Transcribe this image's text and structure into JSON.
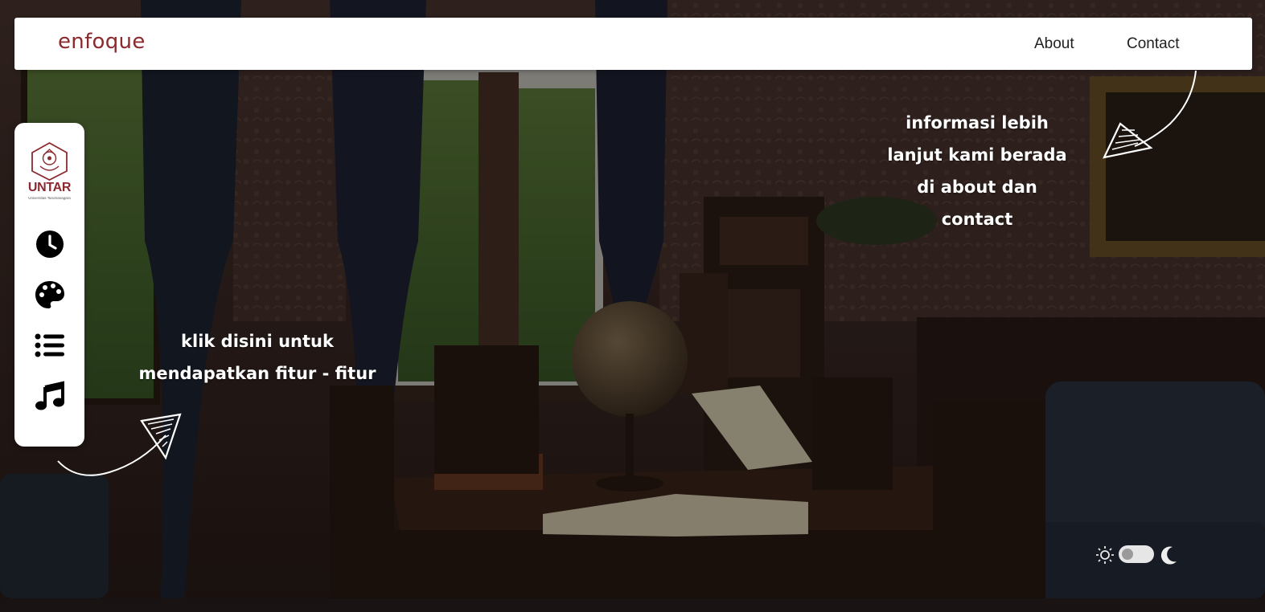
{
  "navbar": {
    "brand": "enfoque",
    "links": {
      "about": "About",
      "contact": "Contact"
    }
  },
  "sidebar": {
    "logo": {
      "text": "UNTAR",
      "subtext": "Universitas Tarumanagara"
    },
    "buttons": [
      {
        "icon": "clock-icon"
      },
      {
        "icon": "palette-icon"
      },
      {
        "icon": "list-icon"
      },
      {
        "icon": "music-note-icon"
      }
    ]
  },
  "notes": {
    "left": {
      "line1": "klik disini untuk",
      "line2": "mendapatkan fitur - fitur"
    },
    "right": {
      "line1": "informasi lebih",
      "line2": "lanjut kami berada",
      "line3": "di about dan",
      "line4": "contact"
    }
  },
  "theme_toggle": {
    "light_icon": "sun-icon",
    "dark_icon": "moon-icon",
    "state": "light"
  },
  "colors": {
    "brand": "#8a2a2f",
    "navbar_bg": "#ffffff",
    "page_bg": "#1b1516"
  }
}
